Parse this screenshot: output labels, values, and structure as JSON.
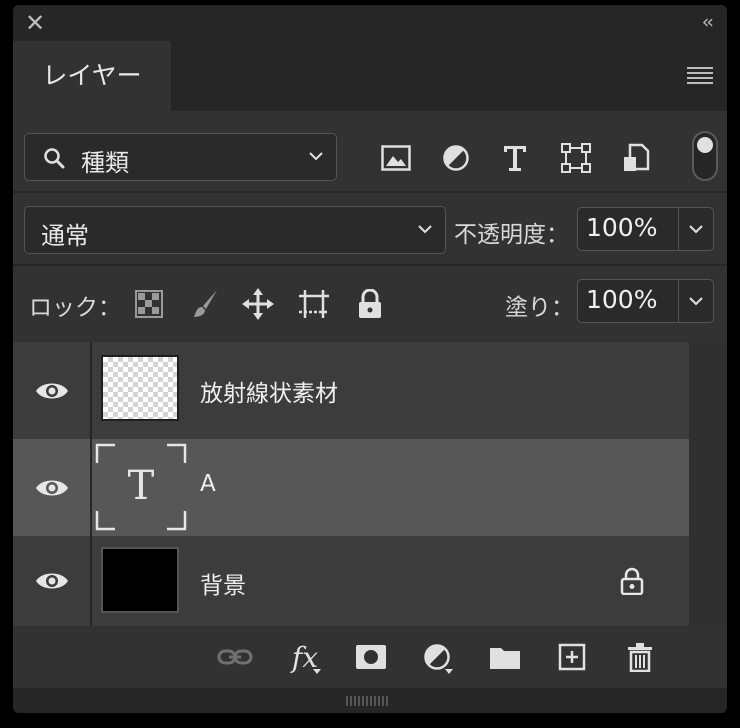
{
  "window": {
    "close_icon": "close-icon",
    "collapse_icon": "double-chevron-left-icon",
    "collapse_glyph": "‹‹"
  },
  "tab": {
    "label": "レイヤー",
    "menu_icon": "hamburger-menu-icon"
  },
  "filter": {
    "kind_label": "種類",
    "icons": [
      "image-layer-filter-icon",
      "adjustment-filter-icon",
      "type-filter-icon",
      "shape-filter-icon",
      "smart-object-filter-icon"
    ],
    "toggle_on": true
  },
  "blend": {
    "mode": "通常",
    "opacity_label": "不透明度：",
    "opacity_value": "100%"
  },
  "lock": {
    "label": "ロック：",
    "fill_label": "塗り：",
    "fill_value": "100%"
  },
  "layers": [
    {
      "name": "放射線状素材",
      "visible": true,
      "thumb": "transparent-checker",
      "selected": false,
      "locked": false
    },
    {
      "name": "A",
      "visible": true,
      "thumb": "type-layer",
      "thumb_glyph": "T",
      "selected": true,
      "locked": false
    },
    {
      "name": "背景",
      "visible": true,
      "thumb": "black",
      "selected": false,
      "locked": true
    }
  ],
  "bottom_icons": [
    "link-layers-icon",
    "fx-icon",
    "add-mask-icon",
    "adjustment-layer-icon",
    "new-group-icon",
    "new-layer-icon",
    "delete-icon"
  ],
  "bottom_fx_label": "fx",
  "colors": {
    "panel": "#323232",
    "dark": "#262626",
    "selected_row": "#575757",
    "row": "#3c3c3c"
  }
}
